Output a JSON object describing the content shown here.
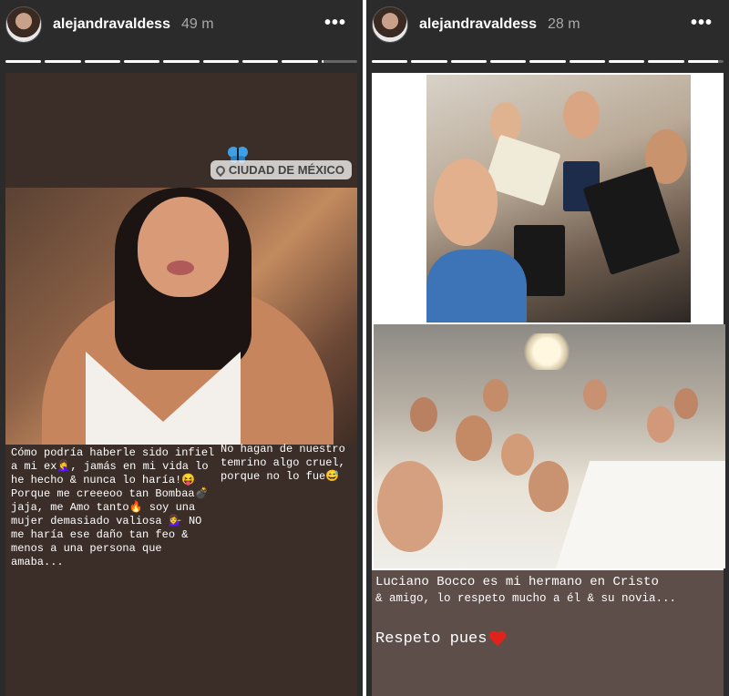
{
  "stories": [
    {
      "username": "alejandravaldess",
      "time": "49 m",
      "more_icon": "•••",
      "progress_fills": [
        1,
        1,
        1,
        1,
        1,
        1,
        1,
        1,
        0.05
      ],
      "location": "CIUDAD DE MÉXICO",
      "caption_left": "Cómo podría haberle sido infiel a mi ex🤦‍♀️, jamás en mi vida lo he hecho & nunca lo haría!😝 Porque me creeeoo tan Bombaa💣 jaja, me Amo tanto🔥 soy una mujer demasiado valiosa 💁‍♀️ NO me haría ese daño tan feo & menos a una persona que amaba...",
      "caption_right": "No hagan de nuestro temrino algo cruel, porque no lo fue😅"
    },
    {
      "username": "alejandravaldess",
      "time": "28 m",
      "more_icon": "•••",
      "progress_fills": [
        1,
        1,
        1,
        1,
        1,
        1,
        1,
        1,
        0.85
      ],
      "caption_line1": "Luciano Bocco es mi hermano en Cristo",
      "caption_line2": "& amigo, lo respeto mucho a él & su novia...",
      "caption_respeto": "Respeto pues"
    }
  ],
  "colors": {
    "bg": "#2b2b2b",
    "caption_bg_left": "#3b2e28",
    "caption_bg_right": "#5d4e49",
    "heart": "#e0221a"
  }
}
